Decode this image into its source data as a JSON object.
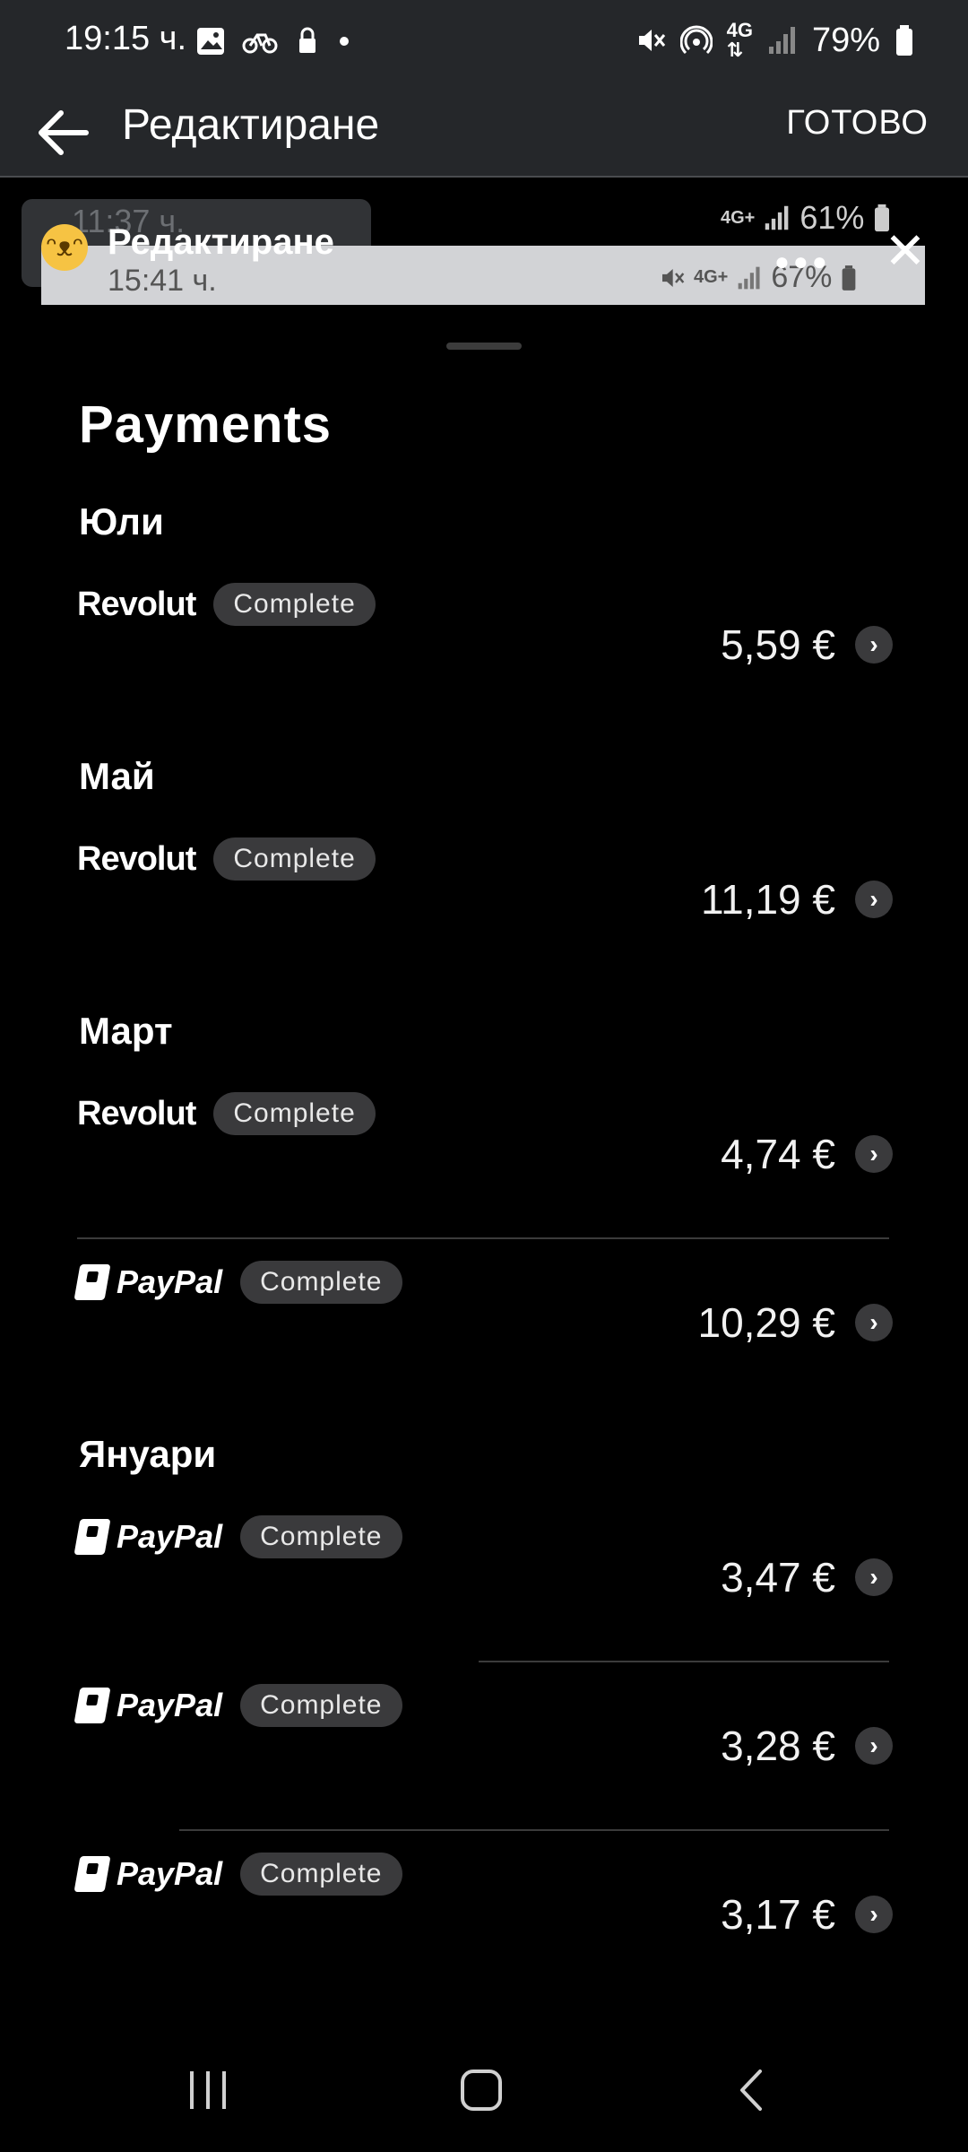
{
  "status_bar": {
    "time": "19:15 ч.",
    "battery": "79%",
    "icons": [
      "gallery-icon",
      "bike-icon",
      "vpn-icon",
      "dot-icon",
      "mute-icon",
      "hotspot-icon",
      "4g-icon",
      "signal-icon",
      "battery-icon"
    ]
  },
  "app_bar": {
    "title": "Редактиране",
    "done_label": "ГОТОВО"
  },
  "overlay": {
    "ghost_time_1": "11:37 ч.",
    "ghost_battery_1": "61%",
    "ghost_time_2": "15:41 ч.",
    "ghost_battery_2": "67%",
    "sticker_title": "Редактиране",
    "network_label": "4G+"
  },
  "sheet": {
    "title": "Payments",
    "groups": [
      {
        "month": "Юли",
        "payments": [
          {
            "provider": "Revolut",
            "status": "Complete",
            "amount": "5,59 €"
          }
        ]
      },
      {
        "month": "Май",
        "payments": [
          {
            "provider": "Revolut",
            "status": "Complete",
            "amount": "11,19 €"
          }
        ]
      },
      {
        "month": "Март",
        "payments": [
          {
            "provider": "Revolut",
            "status": "Complete",
            "amount": "4,74 €"
          },
          {
            "provider": "PayPal",
            "status": "Complete",
            "amount": "10,29 €"
          }
        ]
      },
      {
        "month": "Януари",
        "payments": [
          {
            "provider": "PayPal",
            "status": "Complete",
            "amount": "3,47 €"
          },
          {
            "provider": "PayPal",
            "status": "Complete",
            "amount": "3,28 €"
          },
          {
            "provider": "PayPal",
            "status": "Complete",
            "amount": "3,17 €"
          }
        ]
      }
    ]
  }
}
